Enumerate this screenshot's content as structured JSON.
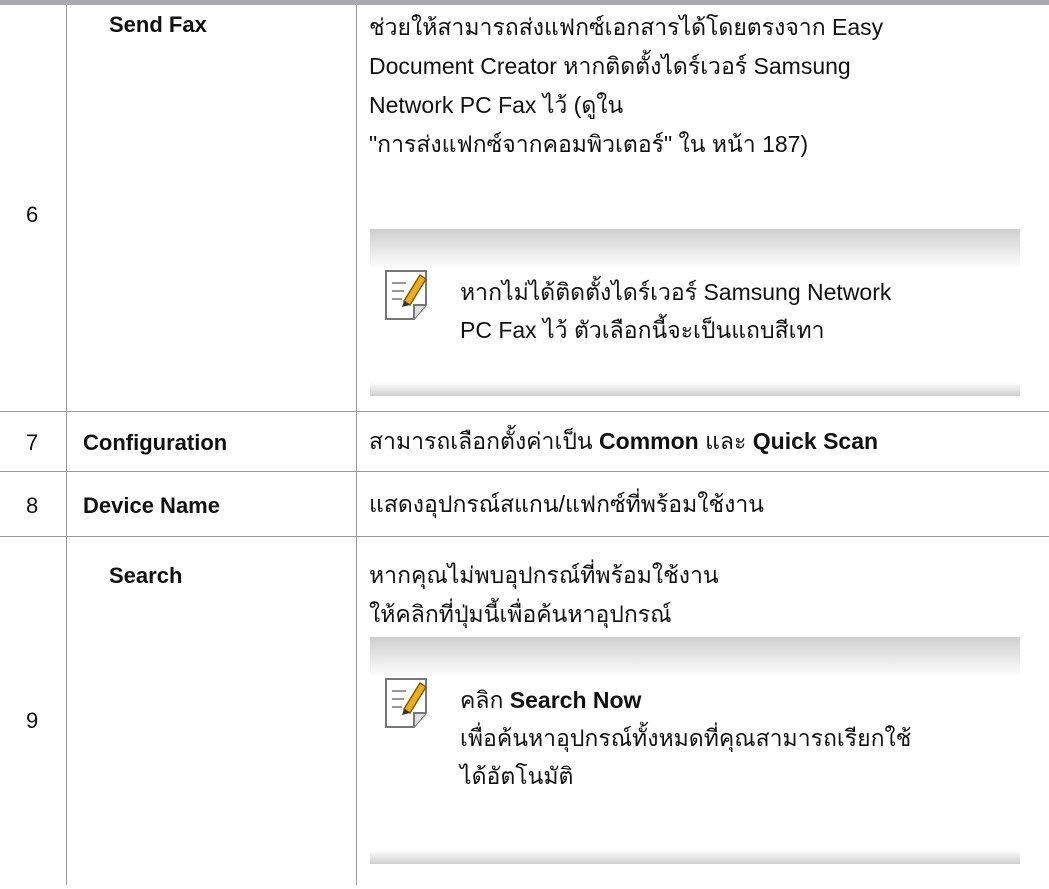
{
  "rows": [
    {
      "number": "6",
      "name": "Send Fax",
      "description_lines": [
        "ช่วยให้สามารถส่งแฟกซ์เอกสารได้โดยตรงจาก Easy",
        "Document Creator หากติดตั้งไดร์เวอร์ Samsung",
        "Network PC Fax ไว้ (ดูใน",
        "\"การส่งแฟกซ์จากคอมพิวเตอร์\"  ใน หน้า 187)"
      ],
      "note_lines": [
        "หากไม่ได้ติดตั้งไดร์เวอร์ Samsung Network",
        "PC Fax ไว้ ตัวเลือกนี้จะเป็นแถบสีเทา"
      ]
    },
    {
      "number": "7",
      "name": "Configuration",
      "desc_pre": "สามารถเลือกตั้งค่าเป็น ",
      "desc_bold1": "Common",
      "desc_mid": " และ ",
      "desc_bold2": "Quick Scan"
    },
    {
      "number": "8",
      "name": "Device Name",
      "description": "แสดงอุปกรณ์สแกน/แฟกซ์ที่พร้อมใช้งาน"
    },
    {
      "number": "9",
      "name": "Search",
      "description_lines": [
        "หากคุณไม่พบอุปกรณ์ที่พร้อมใช้งาน",
        "ให้คลิกที่ปุ่มนี้เพื่อค้นหาอุปกรณ์"
      ],
      "note_pre": "คลิก ",
      "note_bold": "Search Now",
      "note_lines": [
        "เพื่อค้นหาอุปกรณ์ทั้งหมดที่คุณสามารถเรียกใช้",
        "ได้อัตโนมัติ"
      ]
    }
  ],
  "icons": {
    "note": "pencil-note-icon"
  },
  "colors": {
    "rule": "#9a9aa0",
    "topbar": "#a9a9b0",
    "note_gray": "#cfcfcf",
    "pencil": "#e8b020"
  }
}
